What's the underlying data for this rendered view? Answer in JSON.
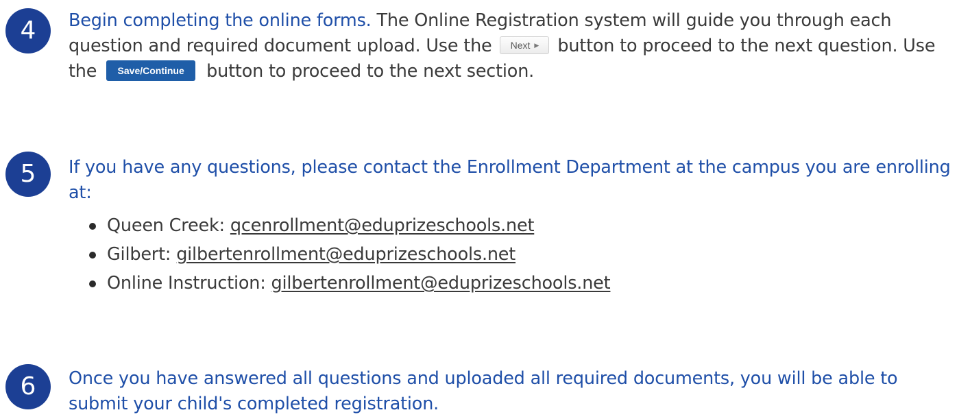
{
  "steps": {
    "four": {
      "number": "4",
      "lead": "Begin completing the online forms.",
      "text_a": "  The Online Registration system will guide you through each question and required document upload.  Use the",
      "next_button_label": "Next",
      "next_arrow": "▶",
      "text_b": "button to proceed to the next question.  Use the",
      "save_button_label": "Save/Continue",
      "text_c": "button to proceed to the next section."
    },
    "five": {
      "number": "5",
      "lead": "If you have any questions, please contact the Enrollment Department at the campus you are enrolling at:",
      "contacts": [
        {
          "campus": "Queen Creek: ",
          "email": "qcenrollment@eduprizeschools.net"
        },
        {
          "campus": "Gilbert: ",
          "email": "gilbertenrollment@eduprizeschools.net"
        },
        {
          "campus": "Online Instruction: ",
          "email": "gilbertenrollment@eduprizeschools.net"
        }
      ]
    },
    "six": {
      "number": "6",
      "lead": "Once you have answered all questions and uploaded all required documents, you will be able to submit your child's completed registration."
    }
  },
  "colors": {
    "badge": "#1c3f94",
    "lead_text": "#1f4fa8",
    "body_text": "#3a3a3a",
    "save_button": "#1f5ea8"
  }
}
